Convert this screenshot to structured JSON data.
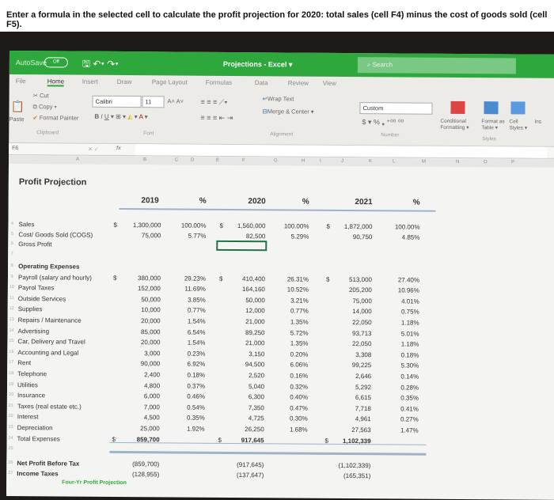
{
  "question": "Enter a formula in the selected cell to calculate the profit projection for 2020: total sales (cell F4) minus the cost of goods sold (cell F5).",
  "titlebar": {
    "autosave": "AutoSave",
    "autosave_state": "Off",
    "title": "Projections - Excel ▾",
    "search_placeholder": "Search"
  },
  "tabs": [
    "File",
    "Home",
    "Insert",
    "Draw",
    "Page Layout",
    "Formulas",
    "Data",
    "Review",
    "View"
  ],
  "ribbon": {
    "cut": "Cut",
    "copy": "Copy ▾",
    "paste": "Paste",
    "format_painter": "Format Painter",
    "clipboard": "Clipboard",
    "font_name": "Calibri",
    "font_size": "11",
    "font": "Font",
    "wrap_text": "Wrap Text",
    "merge_center": "Merge & Center ▾",
    "alignment": "Alignment",
    "number_format": "Custom",
    "number_symbols": "$ ▾ % ❟ ⁺⁰⁰ ⁰⁰",
    "number": "Number",
    "conditional_formatting": "Conditional Formatting ▾",
    "format_as_table": "Format as Table ▾",
    "cell_styles": "Cell Styles ▾",
    "styles": "Styles",
    "insert": "Ins"
  },
  "formula_bar": {
    "name_box": "F6",
    "fx": "fx",
    "value": ""
  },
  "columns": [
    "A",
    "B",
    "C",
    "D",
    "E",
    "F",
    "G",
    "H",
    "I",
    "J",
    "K",
    "L",
    "M",
    "N",
    "O",
    "P"
  ],
  "sheet": {
    "title": "Profit Projection",
    "headers": {
      "y2019": "2019",
      "p1": "%",
      "y2020": "2020",
      "p2": "%",
      "y2021": "2021",
      "p3": "%"
    },
    "rows": [
      {
        "n": "4",
        "label": "Sales",
        "d1": "$",
        "v1": "1,300,000",
        "p1": "100.00%",
        "d2": "$",
        "v2": "1,560,000",
        "p2": "100.00%",
        "d3": "$",
        "v3": "1,872,000",
        "p3": "100.00%"
      },
      {
        "n": "5",
        "label": "Cost/ Goods Sold (COGS)",
        "v1": "75,000",
        "p1": "5.77%",
        "v2": "82,500",
        "p2": "5.29%",
        "v3": "90,750",
        "p3": "4.85%"
      },
      {
        "n": "6",
        "label": "Gross Profit"
      },
      {
        "n": "7",
        "label": ""
      },
      {
        "n": "8",
        "label": "Operating Expenses",
        "bold": true
      },
      {
        "n": "9",
        "label": "Payroll (salary and hourly)",
        "d1": "$",
        "v1": "380,000",
        "p1": "29.23%",
        "d2": "$",
        "v2": "410,400",
        "p2": "26.31%",
        "d3": "$",
        "v3": "513,000",
        "p3": "27.40%"
      },
      {
        "n": "10",
        "label": "Payrol Taxes",
        "v1": "152,000",
        "p1": "11.69%",
        "v2": "164,160",
        "p2": "10.52%",
        "v3": "205,200",
        "p3": "10.96%"
      },
      {
        "n": "11",
        "label": "Outside Services",
        "v1": "50,000",
        "p1": "3.85%",
        "v2": "50,000",
        "p2": "3.21%",
        "v3": "75,000",
        "p3": "4.01%"
      },
      {
        "n": "12",
        "label": "Supplies",
        "v1": "10,000",
        "p1": "0.77%",
        "v2": "12,000",
        "p2": "0.77%",
        "v3": "14,000",
        "p3": "0.75%"
      },
      {
        "n": "13",
        "label": "Repairs / Maintenance",
        "v1": "20,000",
        "p1": "1.54%",
        "v2": "21,000",
        "p2": "1.35%",
        "v3": "22,050",
        "p3": "1.18%"
      },
      {
        "n": "14",
        "label": "Advertising",
        "v1": "85,000",
        "p1": "6.54%",
        "v2": "89,250",
        "p2": "5.72%",
        "v3": "93,713",
        "p3": "5.01%"
      },
      {
        "n": "15",
        "label": "Car, Delivery and Travel",
        "v1": "20,000",
        "p1": "1.54%",
        "v2": "21,000",
        "p2": "1.35%",
        "v3": "22,050",
        "p3": "1.18%"
      },
      {
        "n": "16",
        "label": "Accounting and Legal",
        "v1": "3,000",
        "p1": "0.23%",
        "v2": "3,150",
        "p2": "0.20%",
        "v3": "3,308",
        "p3": "0.18%"
      },
      {
        "n": "17",
        "label": "Rent",
        "v1": "90,000",
        "p1": "6.92%",
        "v2": "94,500",
        "p2": "6.06%",
        "v3": "99,225",
        "p3": "5.30%"
      },
      {
        "n": "18",
        "label": "Telephone",
        "v1": "2,400",
        "p1": "0.18%",
        "v2": "2,520",
        "p2": "0.16%",
        "v3": "2,646",
        "p3": "0.14%"
      },
      {
        "n": "19",
        "label": "Utilities",
        "v1": "4,800",
        "p1": "0.37%",
        "v2": "5,040",
        "p2": "0.32%",
        "v3": "5,292",
        "p3": "0.28%"
      },
      {
        "n": "20",
        "label": "Insurance",
        "v1": "6,000",
        "p1": "0.46%",
        "v2": "6,300",
        "p2": "0.40%",
        "v3": "6,615",
        "p3": "0.35%"
      },
      {
        "n": "21",
        "label": "Taxes (real estate etc.)",
        "v1": "7,000",
        "p1": "0.54%",
        "v2": "7,350",
        "p2": "0.47%",
        "v3": "7,718",
        "p3": "0.41%"
      },
      {
        "n": "22",
        "label": "Interest",
        "v1": "4,500",
        "p1": "0.35%",
        "v2": "4,725",
        "p2": "0.30%",
        "v3": "4,961",
        "p3": "0.27%"
      },
      {
        "n": "23",
        "label": "Depreciation",
        "v1": "25,000",
        "p1": "1.92%",
        "v2": "26,250",
        "p2": "1.68%",
        "v3": "27,563",
        "p3": "1.47%"
      },
      {
        "n": "24",
        "label": "Total Expenses",
        "d1": "$",
        "v1": "859,700",
        "d2": "$",
        "v2": "917,645",
        "d3": "$",
        "v3": "1,102,339",
        "boldv": true
      },
      {
        "n": "25",
        "label": ""
      },
      {
        "n": "26",
        "label": "Net Profit Before Tax",
        "bold": true,
        "v1": "(859,700)",
        "v2": "(917,645)",
        "v3": "(1,102,339)"
      },
      {
        "n": "27",
        "label": "Income Taxes",
        "bold": true,
        "v1": "(128,955)",
        "v2": "(137,647)",
        "v3": "(165,351)"
      }
    ],
    "sheet_tab": "Four-Yr Profit Projection"
  }
}
